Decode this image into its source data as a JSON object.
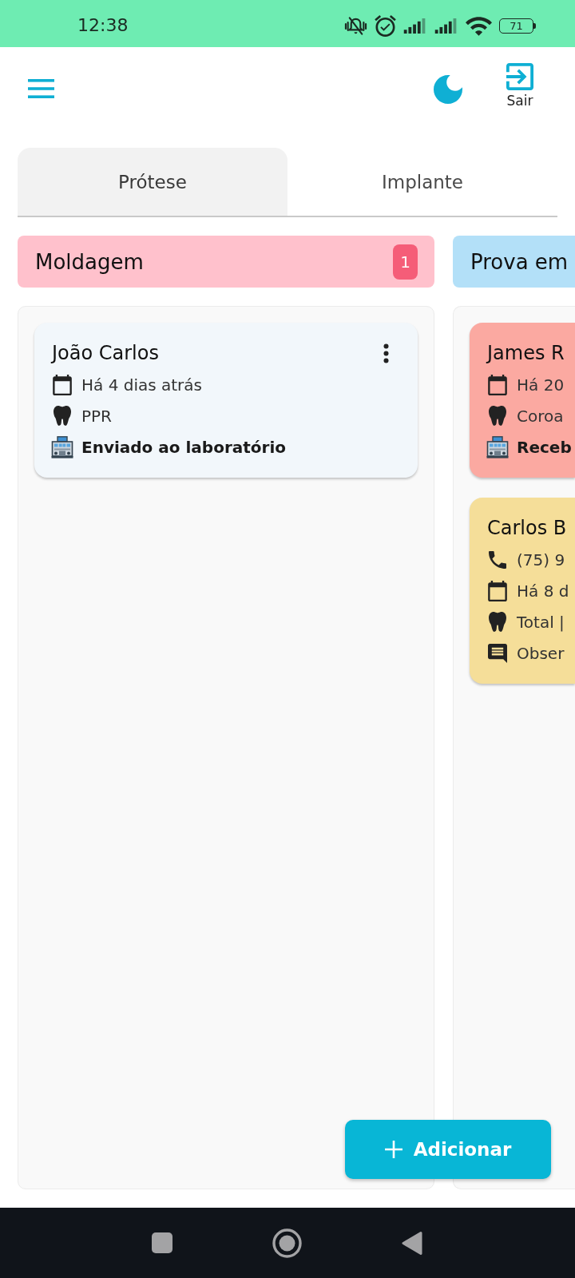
{
  "status_bar": {
    "time": "12:38",
    "battery": "71"
  },
  "app_bar": {
    "logout_label": "Sair"
  },
  "tabs": [
    {
      "label": "Prótese",
      "selected": true
    },
    {
      "label": "Implante",
      "selected": false
    }
  ],
  "columns": [
    {
      "title": "Moldagem",
      "color": "#ffc1cc",
      "count": "1",
      "cards": [
        {
          "name": "João Carlos",
          "color": "#f2f7fb",
          "menu": true,
          "details": [
            {
              "kind": "date",
              "text": "Há 4 dias atrás"
            },
            {
              "kind": "prosthesis",
              "text": "PPR"
            },
            {
              "kind": "lab",
              "text": "Enviado ao laboratório"
            }
          ]
        }
      ]
    },
    {
      "title": "Prova em",
      "color": "#b3e0f8",
      "cards": [
        {
          "name": "James R",
          "color": "#fba9a1",
          "details": [
            {
              "kind": "date",
              "text": "Há 20"
            },
            {
              "kind": "prosthesis",
              "text": "Coroa"
            },
            {
              "kind": "lab",
              "text": "Receb"
            }
          ]
        },
        {
          "name": "Carlos B",
          "color": "#f5de99",
          "details": [
            {
              "kind": "phone",
              "text": "(75) 9"
            },
            {
              "kind": "date",
              "text": "Há 8 d"
            },
            {
              "kind": "prosthesis",
              "text": "Total |"
            },
            {
              "kind": "note",
              "text": "Obser"
            }
          ]
        }
      ]
    }
  ],
  "add_button": {
    "label": "Adicionar"
  }
}
